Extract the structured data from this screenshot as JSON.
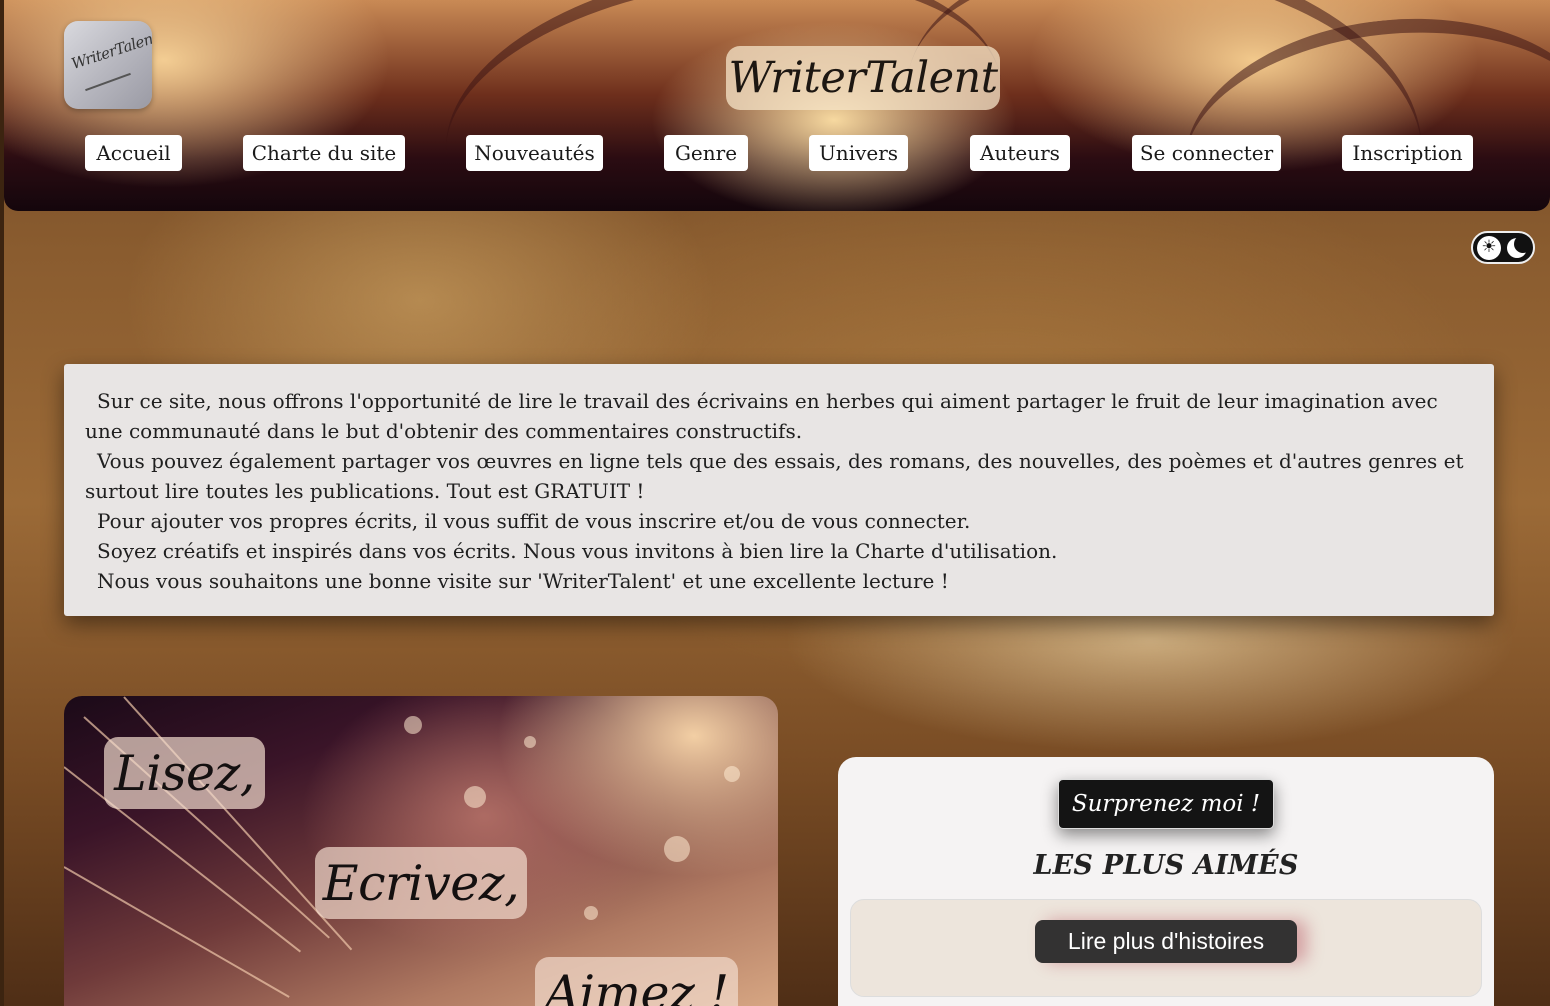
{
  "header": {
    "logo_text": "WriterTalent",
    "site_title": "WriterTalent",
    "nav": [
      {
        "label": "Accueil"
      },
      {
        "label": "Charte du site"
      },
      {
        "label": "Nouveautés"
      },
      {
        "label": "Genre"
      },
      {
        "label": "Univers"
      },
      {
        "label": "Auteurs"
      },
      {
        "label": "Se connecter"
      },
      {
        "label": "Inscription"
      }
    ]
  },
  "theme_toggle": {
    "light_icon": "sun-icon",
    "dark_icon": "moon-icon"
  },
  "intro": {
    "paragraphs": [
      "Sur ce site, nous offrons l'opportunité de lire le travail des écrivains en herbes qui aiment partager le fruit de leur imagination avec une communauté dans le but d'obtenir des commentaires constructifs.",
      "Vous pouvez également partager vos œuvres en ligne tels que des essais, des romans, des nouvelles, des poèmes et d'autres genres et surtout lire toutes les publications. Tout est GRATUIT !",
      "Pour ajouter vos propres écrits, il vous suffit de vous inscrire et/ou de vous connecter.",
      "Soyez créatifs et inspirés dans vos écrits. Nous vous invitons à bien lire la Charte d'utilisation.",
      "Nous vous souhaitons une bonne visite sur 'WriterTalent' et une excellente lecture !"
    ]
  },
  "hero": {
    "motto": [
      "Lisez,",
      "Ecrivez,",
      "Aimez !"
    ]
  },
  "panel": {
    "surprise_label": "Surprenez moi !",
    "popular_title": "LES PLUS AIMÉS",
    "more_label": "Lire plus d'histoires"
  },
  "colors": {
    "nav_bg": "#ffffff",
    "intro_bg": "#e8e5e4",
    "panel_bg": "#f5f3f3",
    "button_dark": "#141414"
  }
}
